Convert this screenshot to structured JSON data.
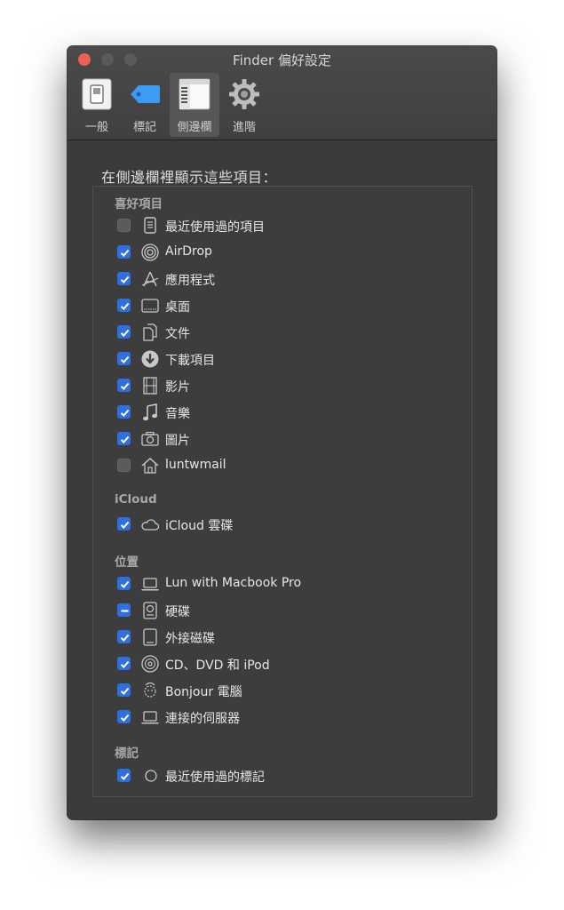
{
  "window": {
    "title": "Finder 偏好設定"
  },
  "tabs": [
    {
      "label": "一般",
      "icon": "general-switch-icon"
    },
    {
      "label": "標記",
      "icon": "tag-icon"
    },
    {
      "label": "側邊欄",
      "icon": "sidebar-icon"
    },
    {
      "label": "進階",
      "icon": "gear-icon"
    }
  ],
  "selected_tab": "側邊欄",
  "heading": "在側邊欄裡顯示這些項目：",
  "sections": {
    "favorites": "喜好項目",
    "icloud": "iCloud",
    "locations": "位置",
    "tags": "標記"
  },
  "items": [
    {
      "label": "最近使用過的項目",
      "state": "unchecked",
      "icon": "recents-icon"
    },
    {
      "label": "AirDrop",
      "state": "checked",
      "icon": "airdrop-icon"
    },
    {
      "label": "應用程式",
      "state": "checked",
      "icon": "applications-icon"
    },
    {
      "label": "桌面",
      "state": "checked",
      "icon": "desktop-icon"
    },
    {
      "label": "文件",
      "state": "checked",
      "icon": "documents-icon"
    },
    {
      "label": "下載項目",
      "state": "checked",
      "icon": "downloads-icon"
    },
    {
      "label": "影片",
      "state": "checked",
      "icon": "movies-icon"
    },
    {
      "label": "音樂",
      "state": "checked",
      "icon": "music-icon"
    },
    {
      "label": "圖片",
      "state": "checked",
      "icon": "pictures-icon"
    },
    {
      "label": "luntwmail",
      "state": "unchecked",
      "icon": "home-icon"
    },
    {
      "label": "iCloud 雲碟",
      "state": "checked",
      "icon": "cloud-icon"
    },
    {
      "label": "Lun with Macbook Pro",
      "state": "checked",
      "icon": "laptop-icon"
    },
    {
      "label": "硬碟",
      "state": "mixed",
      "icon": "hard-disk-icon"
    },
    {
      "label": "外接磁碟",
      "state": "checked",
      "icon": "external-disk-icon"
    },
    {
      "label": "CD、DVD 和 iPod",
      "state": "checked",
      "icon": "optical-disc-icon"
    },
    {
      "label": "Bonjour 電腦",
      "state": "checked",
      "icon": "bonjour-icon"
    },
    {
      "label": "連接的伺服器",
      "state": "checked",
      "icon": "server-icon"
    },
    {
      "label": "最近使用過的標記",
      "state": "checked",
      "icon": "recent-tags-icon"
    }
  ]
}
